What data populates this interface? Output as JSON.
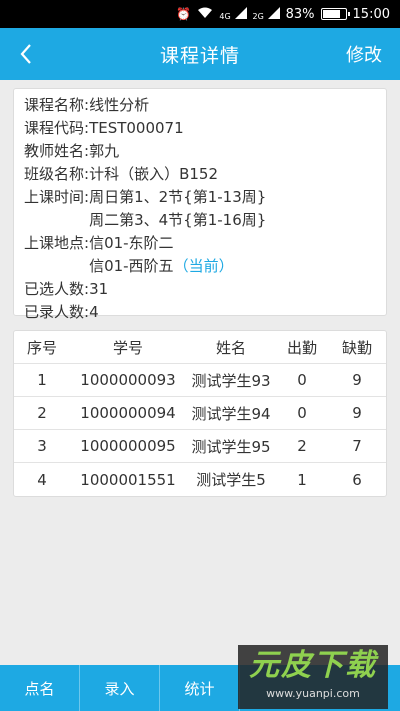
{
  "status_bar": {
    "signal_4g": "4G",
    "signal_2g": "2G",
    "battery_text": "83%",
    "battery_level": 0.83,
    "time": "15:00"
  },
  "navbar": {
    "title": "课程详情",
    "edit_label": "修改"
  },
  "course": {
    "name_label": "课程名称:",
    "name": "线性分析",
    "code_label": "课程代码:",
    "code": "TEST000071",
    "teacher_label": "教师姓名:",
    "teacher": "郭九",
    "class_label": "班级名称:",
    "class_name": "计科（嵌入）B152",
    "time_label": "上课时间:",
    "times": [
      "周日第1、2节{第1-13周}",
      "周二第3、4节{第1-16周}"
    ],
    "location_label": "上课地点:",
    "locations": [
      "信01-东阶二",
      "信01-西阶五"
    ],
    "current_tag": "（当前）",
    "selected_label": "已选人数:",
    "selected_count": "31",
    "recorded_label": "已录人数:",
    "recorded_count": "4"
  },
  "table": {
    "headers": [
      "序号",
      "学号",
      "姓名",
      "出勤",
      "缺勤"
    ],
    "rows": [
      [
        "1",
        "1000000093",
        "测试学生93",
        "0",
        "9"
      ],
      [
        "2",
        "1000000094",
        "测试学生94",
        "0",
        "9"
      ],
      [
        "3",
        "1000000095",
        "测试学生95",
        "2",
        "7"
      ],
      [
        "4",
        "1000001551",
        "测试学生5",
        "1",
        "6"
      ]
    ]
  },
  "tabbar": {
    "items": [
      "点名",
      "录入",
      "统计"
    ]
  },
  "watermark": {
    "logo": "元皮下载",
    "url": "www.yuanpi.com"
  },
  "colors": {
    "primary": "#1ea9e3",
    "background": "#ececec"
  }
}
